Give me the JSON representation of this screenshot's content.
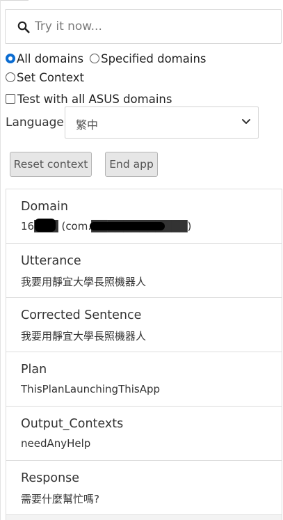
{
  "search": {
    "placeholder": "Try it now...",
    "value": ""
  },
  "options": {
    "all_domains_label": "All domains",
    "specified_domains_label": "Specified domains",
    "set_context_label": "Set Context",
    "test_all_label": "Test with all ASUS domains",
    "selected": "All domains",
    "test_all_checked": false
  },
  "language": {
    "label": "Language",
    "selected": "繁中"
  },
  "buttons": {
    "reset_context": "Reset context",
    "end_app": "End app"
  },
  "results": [
    {
      "title": "Domain",
      "value": "16███ (com.████████████)"
    },
    {
      "title": "Utterance",
      "value": "我要用靜宜大學長照機器人"
    },
    {
      "title": "Corrected Sentence",
      "value": "我要用靜宜大學長照機器人"
    },
    {
      "title": "Plan",
      "value": "ThisPlanLaunchingThisApp"
    },
    {
      "title": "Output_Contexts",
      "value": "needAnyHelp"
    },
    {
      "title": "Response",
      "value": "需要什麼幫忙嗎?"
    }
  ],
  "colors": {
    "accent": "#0b6cd1",
    "button_bg": "#e6e6e6",
    "border": "#dddddd"
  }
}
